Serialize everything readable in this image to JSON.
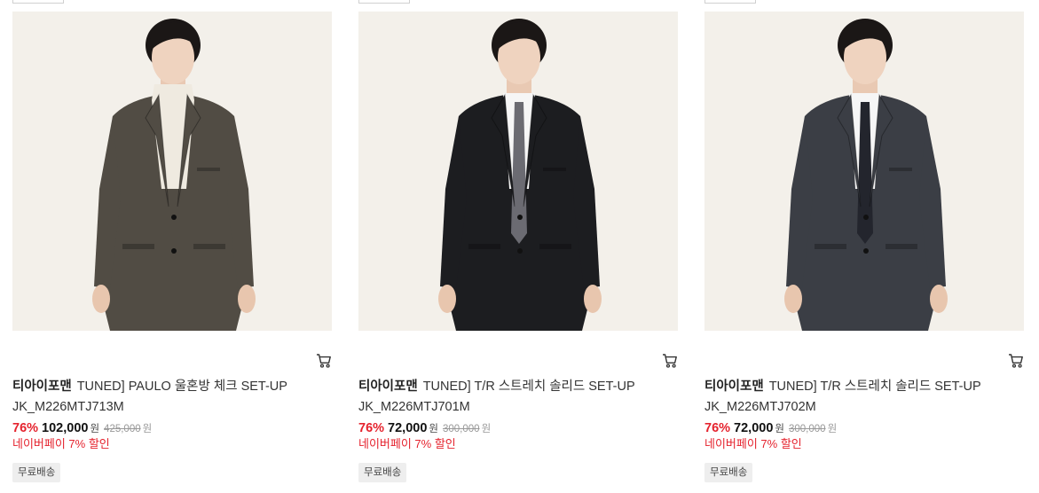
{
  "products": [
    {
      "brand": "티아이포맨",
      "name": "TUNED] PAULO 울혼방 체크 SET-UP",
      "code": "JK_M226MTJ713M",
      "discount": "76%",
      "price": "102,000",
      "price_unit": "원",
      "original_price": "425,000",
      "original_unit": "원",
      "naverpay": "네이버페이 7% 할인",
      "shipping": "무료배송",
      "suit_color": "#514c44",
      "inner": "turtleneck",
      "inner_color": "#efeae0",
      "tie_color": ""
    },
    {
      "brand": "티아이포맨",
      "name": "TUNED] T/R 스트레치 솔리드 SET-UP",
      "code": "JK_M226MTJ701M",
      "discount": "76%",
      "price": "72,000",
      "price_unit": "원",
      "original_price": "300,000",
      "original_unit": "원",
      "naverpay": "네이버페이 7% 할인",
      "shipping": "무료배송",
      "suit_color": "#1c1d20",
      "inner": "shirt",
      "inner_color": "#f6f6f6",
      "tie_color": "#6b6b72"
    },
    {
      "brand": "티아이포맨",
      "name": "TUNED] T/R 스트레치 솔리드 SET-UP",
      "code": "JK_M226MTJ702M",
      "discount": "76%",
      "price": "72,000",
      "price_unit": "원",
      "original_price": "300,000",
      "original_unit": "원",
      "naverpay": "네이버페이 7% 할인",
      "shipping": "무료배송",
      "suit_color": "#3b3e45",
      "inner": "shirt",
      "inner_color": "#f6f6f6",
      "tie_color": "#23252d"
    }
  ],
  "icons": {
    "cart": "cart-icon"
  },
  "colors": {
    "accent_red": "#e5232e",
    "badge_bg": "#eeeeee"
  }
}
